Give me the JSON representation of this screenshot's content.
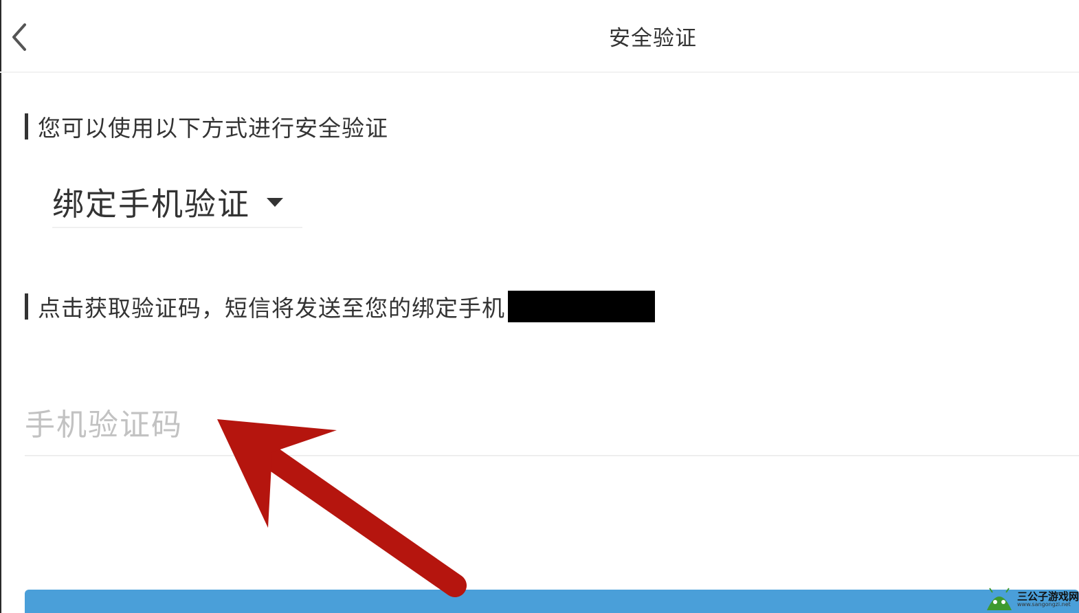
{
  "header": {
    "title": "安全验证",
    "back_icon": "chevron-left-icon"
  },
  "verify_methods": {
    "label": "您可以使用以下方式进行安全验证",
    "selected": "绑定手机验证"
  },
  "sms": {
    "info": "点击获取验证码，短信将发送至您的绑定手机"
  },
  "code_input": {
    "placeholder": "手机验证码",
    "value": ""
  },
  "watermark": {
    "title": "三公子游戏网",
    "url": "www.sangongzi.net"
  },
  "colors": {
    "primary": "#4a9fd9",
    "annotation_arrow": "#b5150e"
  }
}
